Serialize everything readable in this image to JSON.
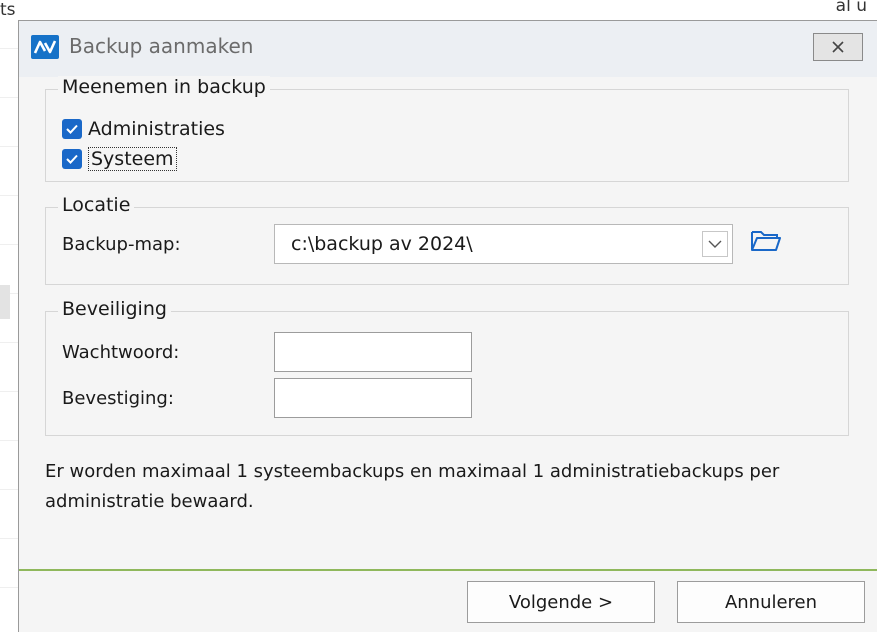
{
  "background": {
    "left_fragment": "ts",
    "right_fragment": "al u"
  },
  "dialog": {
    "title": "Backup aanmaken",
    "groups": {
      "include": {
        "legend": "Meenemen in backup",
        "items": [
          {
            "label": "Administraties",
            "checked": true
          },
          {
            "label": "Systeem",
            "checked": true
          }
        ]
      },
      "location": {
        "legend": "Locatie",
        "folder_label": "Backup-map:",
        "folder_value": "c:\\backup av 2024\\"
      },
      "security": {
        "legend": "Beveiliging",
        "password_label": "Wachtwoord:",
        "password_value": "",
        "confirm_label": "Bevestiging:",
        "confirm_value": ""
      }
    },
    "info": "Er worden maximaal 1 systeembackups en maximaal 1 administratiebackups per administratie bewaard.",
    "buttons": {
      "next": "Volgende >",
      "cancel": "Annuleren"
    },
    "colors": {
      "accent": "#1a68c8",
      "separator": "#8fb85c"
    }
  }
}
